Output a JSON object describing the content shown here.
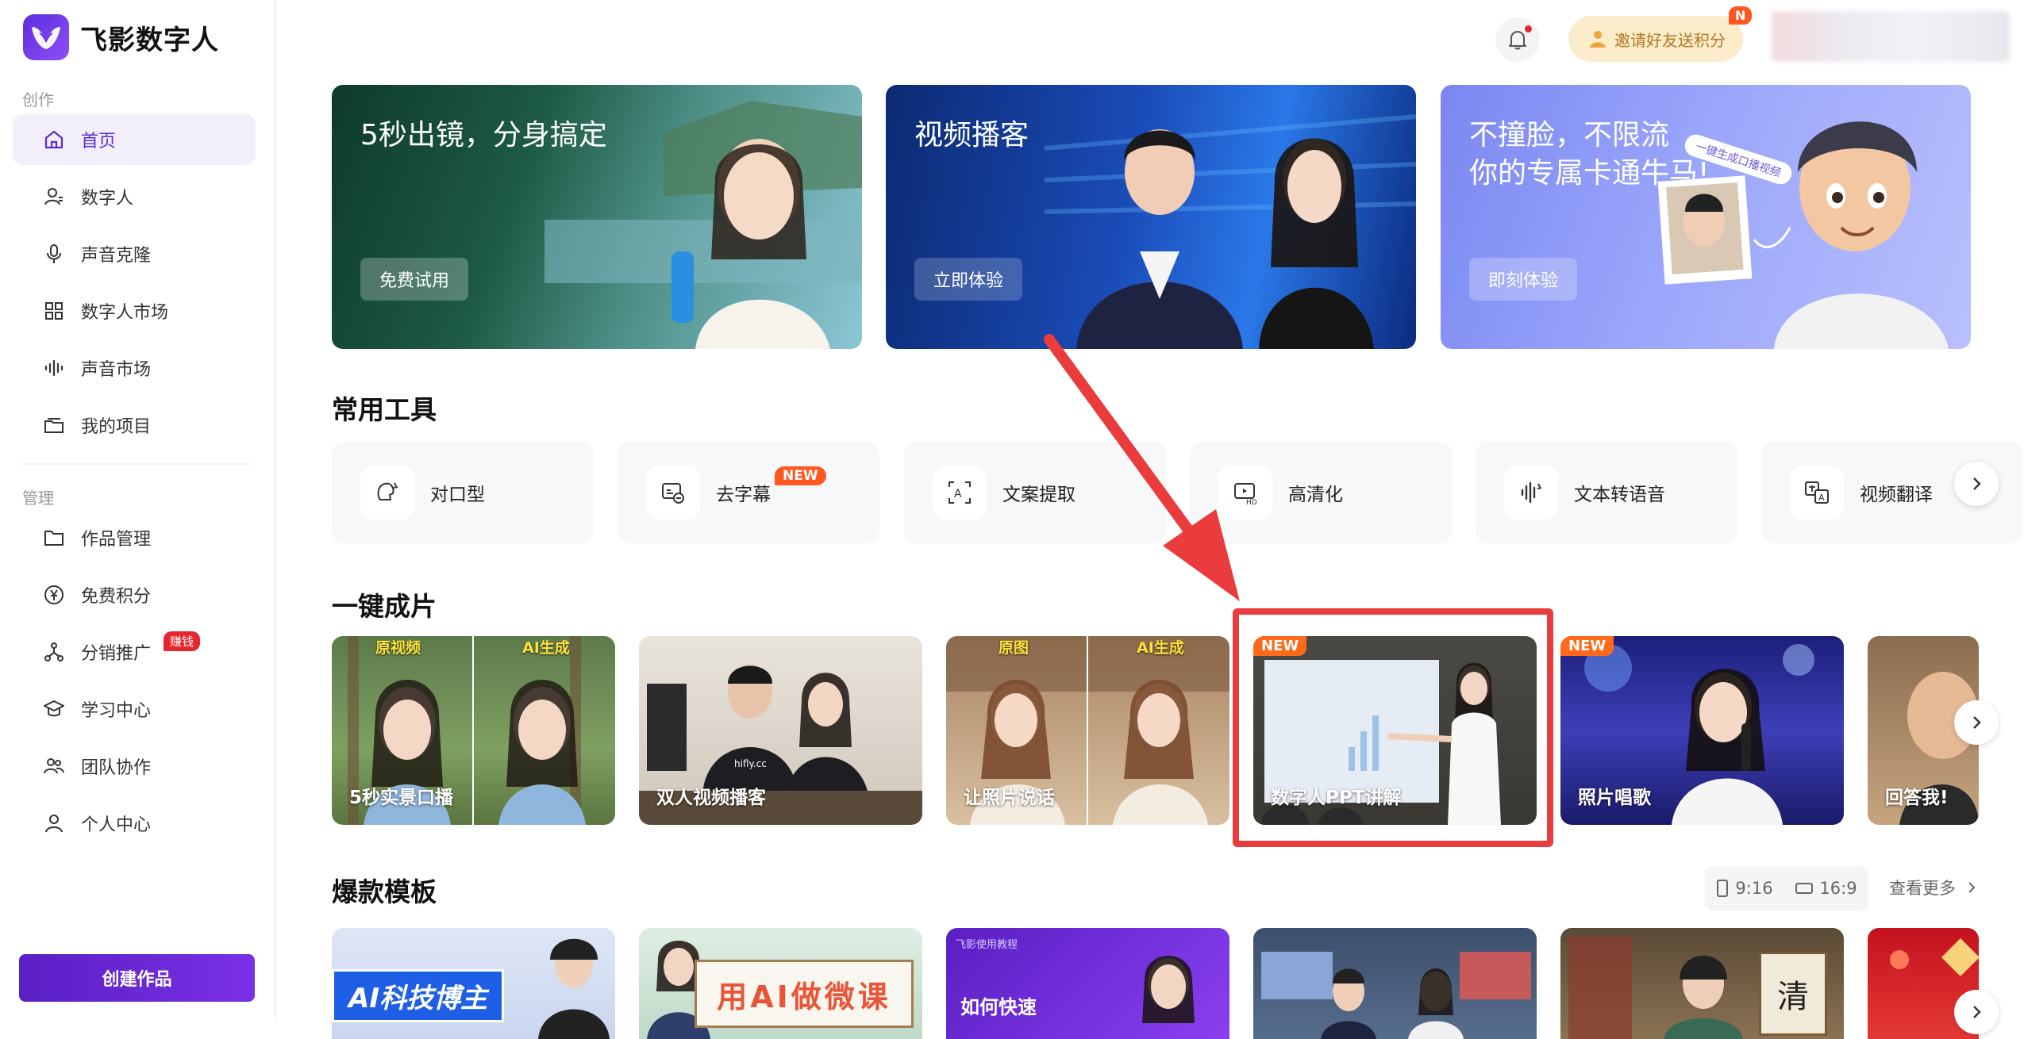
{
  "app": {
    "name": "飞影数字人"
  },
  "sidebar": {
    "section_create": "创作",
    "section_manage": "管理",
    "items": [
      {
        "label": "首页",
        "icon": "home-icon",
        "active": true
      },
      {
        "label": "数字人",
        "icon": "digital-human-icon"
      },
      {
        "label": "声音克隆",
        "icon": "microphone-icon"
      },
      {
        "label": "数字人市场",
        "icon": "grid-icon"
      },
      {
        "label": "声音市场",
        "icon": "waveform-icon"
      },
      {
        "label": "我的项目",
        "icon": "folder-stack-icon"
      },
      {
        "label": "作品管理",
        "icon": "folder-icon"
      },
      {
        "label": "免费积分",
        "icon": "yen-circle-icon"
      },
      {
        "label": "分销推广",
        "icon": "share-network-icon",
        "badge": "赚钱"
      },
      {
        "label": "学习中心",
        "icon": "graduation-cap-icon"
      },
      {
        "label": "团队协作",
        "icon": "team-icon"
      },
      {
        "label": "个人中心",
        "icon": "user-icon"
      }
    ],
    "create_button": "创建作品"
  },
  "topbar": {
    "invite_label": "邀请好友送积分",
    "invite_badge": "N"
  },
  "banners": [
    {
      "title": "5秒出镜，分身搞定",
      "button": "免费试用"
    },
    {
      "title": "视频播客",
      "button": "立即体验"
    },
    {
      "title": "不撞脸，不限流\n你的专属卡通牛马!",
      "button": "即刻体验",
      "sticker": "一键生成口播视频"
    }
  ],
  "tools": {
    "title": "常用工具",
    "items": [
      {
        "label": "对口型",
        "icon": "lip-sync-icon"
      },
      {
        "label": "去字幕",
        "icon": "remove-subtitle-icon",
        "badge": "NEW"
      },
      {
        "label": "文案提取",
        "icon": "text-extract-icon"
      },
      {
        "label": "高清化",
        "icon": "hd-icon"
      },
      {
        "label": "文本转语音",
        "icon": "tts-icon"
      },
      {
        "label": "视频翻译",
        "icon": "translate-icon"
      }
    ]
  },
  "oneclick": {
    "title": "一键成片",
    "items": [
      {
        "label": "5秒实景口播",
        "tags": [
          "原视频",
          "AI生成"
        ]
      },
      {
        "label": "双人视频播客",
        "shirt": "hifly.cc"
      },
      {
        "label": "让照片说话",
        "tags": [
          "原图",
          "AI生成"
        ]
      },
      {
        "label": "数字人PPT讲解",
        "badge": "NEW"
      },
      {
        "label": "照片唱歌",
        "badge": "NEW"
      },
      {
        "label": "回答我!"
      }
    ]
  },
  "templates": {
    "title": "爆款模板",
    "ratio_portrait": "9:16",
    "ratio_landscape": "16:9",
    "see_more": "查看更多",
    "items": [
      {
        "text": "AI科技博主"
      },
      {
        "text": "用AI做微课"
      },
      {
        "text": "如何快速",
        "subtext": "飞影使用教程"
      },
      {
        "text": ""
      },
      {
        "text": "清"
      },
      {
        "text": ""
      }
    ]
  },
  "colors": {
    "brand": "#5a2bd6",
    "highlight": "#ea3c3c",
    "new_badge": "#ff5722"
  }
}
